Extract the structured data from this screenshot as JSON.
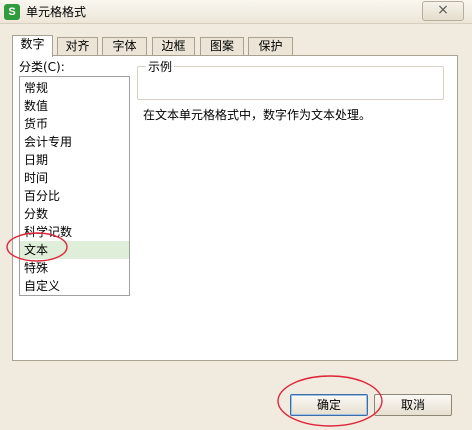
{
  "dialog": {
    "title": "单元格格式",
    "close_glyph": "×"
  },
  "tabs": [
    "数字",
    "对齐",
    "字体",
    "边框",
    "图案",
    "保护"
  ],
  "category": {
    "label": "分类(C):",
    "items": [
      "常规",
      "数值",
      "货币",
      "会计专用",
      "日期",
      "时间",
      "百分比",
      "分数",
      "科学记数",
      "文本",
      "特殊",
      "自定义"
    ],
    "selected": "文本"
  },
  "sample": {
    "title": "示例"
  },
  "description": "在文本单元格格式中，数字作为文本处理。",
  "buttons": {
    "ok": "确定",
    "cancel": "取消"
  },
  "colors": {
    "annotation_circle": "#e0263a",
    "selection_background": "#dfeed9",
    "app_icon": "#2f9b3d"
  }
}
